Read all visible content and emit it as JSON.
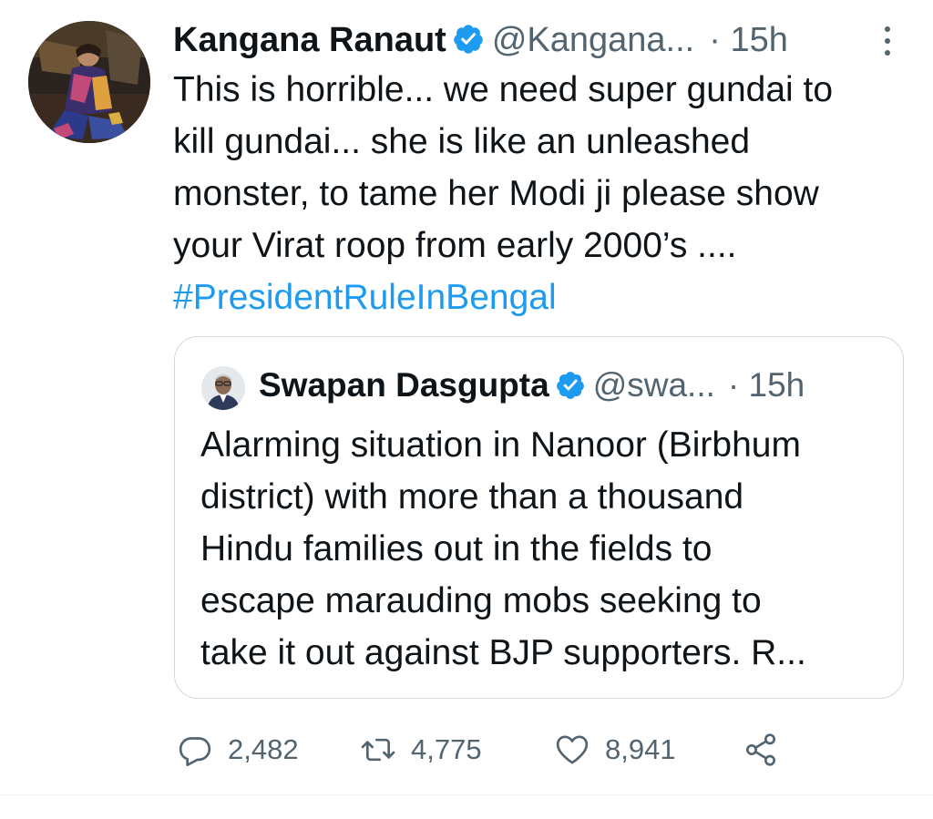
{
  "tweet": {
    "author_name": "Kangana Ranaut",
    "author_handle": "@Kangana...",
    "separator": "·",
    "time": "15h",
    "text_lines": [
      "This is horrible... we need super gundai to",
      "kill gundai... she is like an unleashed",
      "monster, to tame her Modi ji please show",
      "your Virat roop from early 2000’s ...."
    ],
    "hashtag": "#PresidentRuleInBengal",
    "verified": true,
    "more_icon": "vertical-ellipsis-icon"
  },
  "quoted_tweet": {
    "author_name": "Swapan Dasgupta",
    "author_handle": "@swa...",
    "separator": "·",
    "time": "15h",
    "verified": true,
    "text_lines": [
      "Alarming situation in Nanoor (Birbhum",
      "district) with more than a thousand",
      "Hindu families out in the fields to",
      "escape marauding mobs seeking to",
      "take it out against BJP supporters. R..."
    ]
  },
  "actions": {
    "reply": {
      "icon": "reply-icon",
      "count": "2,482"
    },
    "retweet": {
      "icon": "retweet-icon",
      "count": "4,775"
    },
    "like": {
      "icon": "heart-icon",
      "count": "8,941"
    },
    "share": {
      "icon": "share-icon"
    }
  },
  "colors": {
    "text": "#0f1419",
    "secondary": "#536471",
    "accent": "#1d9bf0",
    "border": "#cfd9de"
  }
}
